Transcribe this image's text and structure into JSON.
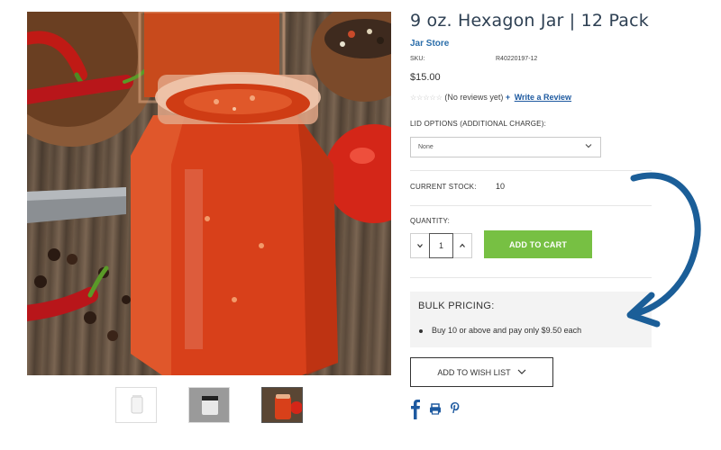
{
  "product": {
    "title": "9 oz. Hexagon Jar | 12 Pack",
    "brand": "Jar Store",
    "sku_label": "SKU:",
    "sku_value": "R40220197-12",
    "price": "$15.00"
  },
  "rating": {
    "stars": "☆☆☆☆☆",
    "reviews_text": "(No reviews yet)",
    "write_review_plus": "+",
    "write_review_label": "Write a Review"
  },
  "lid_options": {
    "label": "LID OPTIONS (ADDITIONAL CHARGE):",
    "selected": "None"
  },
  "stock": {
    "label": "CURRENT STOCK:",
    "value": "10"
  },
  "quantity": {
    "label": "QUANTITY:",
    "value": "1",
    "decrement": "⌄",
    "increment": "⌃"
  },
  "add_to_cart_label": "ADD TO CART",
  "bulk_pricing": {
    "title": "BULK PRICING:",
    "items": [
      "Buy 10 or above and pay only $9.50 each"
    ]
  },
  "wishlist_label": "ADD TO WISH LIST",
  "icons": {
    "social": [
      "facebook-icon",
      "print-icon",
      "pinterest-icon"
    ],
    "lid_chevron": "chevron-down-icon",
    "wishlist_chevron": "chevron-down-icon"
  },
  "colors": {
    "brand_blue": "#2b6eaa",
    "add_to_cart_green": "#77c043",
    "arrow_blue": "#1b5e98"
  }
}
